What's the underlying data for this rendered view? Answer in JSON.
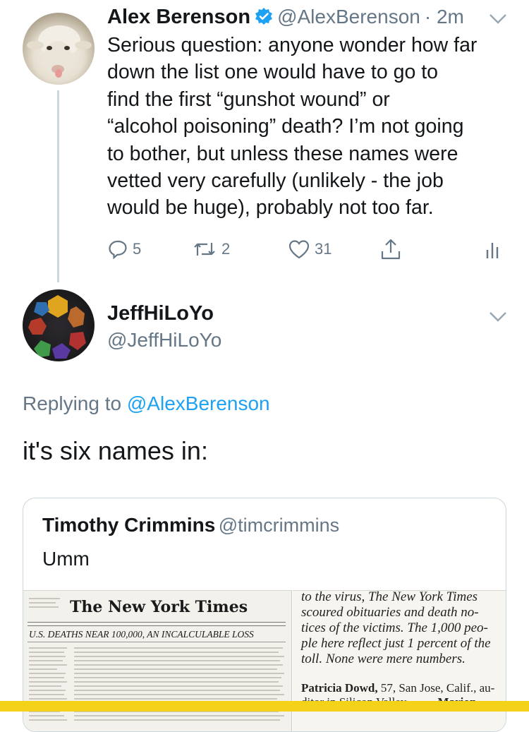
{
  "tweet": {
    "name": "Alex Berenson",
    "handle": "@AlexBerenson",
    "time": "· 2m",
    "text_lines": [
      "Serious question: anyone wonder how far",
      "down the list one would have to go to",
      "find the first “gunshot wound” or",
      "“alcohol poisoning” death? I’m not going",
      "to bother, but unless these names were",
      "vetted very carefully (unlikely - the job",
      "would be huge), probably not too far."
    ],
    "replies": "5",
    "retweets": "2",
    "likes": "31"
  },
  "reply": {
    "name": "JeffHiLoYo",
    "handle": "@JeffHiLoYo",
    "replying_prefix": "Replying to",
    "replying_mention": "@AlexBerenson",
    "text": "it's six names in:"
  },
  "quote": {
    "name": "Timothy Crimmins",
    "handle": "@timcrimmins",
    "text": "Umm"
  },
  "newspaper": {
    "masthead": "The New York Times",
    "headline": "U.S. DEATHS NEAR 100,000, AN INCALCULABLE LOSS",
    "right_lines": [
      "to the virus, The New York Times",
      "scoured obituaries and death no-",
      "tices of the victims. The 1,000 peo-",
      "ple here reflect just 1 percent of the",
      "toll. None were mere numbers."
    ],
    "entry_name": "Patricia Dowd,",
    "entry_rest": " 57, San Jose, Calif., au-",
    "entry_line2": "ditor in Silicon Valley",
    "entry_marker": "·",
    "entry_name2": "Marion"
  },
  "colors": {
    "primary_text": "#14171a",
    "secondary_text": "#657786",
    "link": "#1da1f2",
    "divider": "#ccd6dd",
    "highlight_bar": "#f5d21a"
  }
}
